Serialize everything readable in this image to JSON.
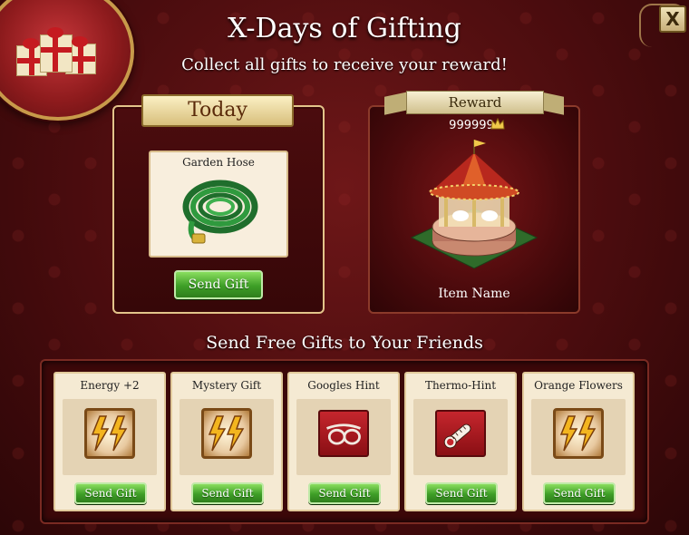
{
  "header": {
    "title": "X-Days of Gifting",
    "subtitle": "Collect all gifts to receive your reward!",
    "close_label": "X"
  },
  "today": {
    "banner": "Today",
    "item_label": "Garden Hose",
    "item_icon": "garden-hose-icon",
    "button_label": "Send Gift"
  },
  "reward": {
    "banner": "Reward",
    "amount": "999999",
    "amount_icon": "crown-icon",
    "item_icon": "carousel-icon",
    "item_name": "Item Name"
  },
  "friends": {
    "title": "Send Free Gifts to Your Friends",
    "gifts": [
      {
        "label": "Energy +2",
        "icon": "energy-bolt-icon",
        "button": "Send Gift"
      },
      {
        "label": "Mystery Gift",
        "icon": "energy-bolt-icon",
        "button": "Send Gift"
      },
      {
        "label": "Googles Hint",
        "icon": "goggles-icon",
        "button": "Send Gift"
      },
      {
        "label": "Thermo-Hint",
        "icon": "thermometer-icon",
        "button": "Send Gift"
      },
      {
        "label": "Orange Flowers",
        "icon": "energy-bolt-icon",
        "button": "Send Gift"
      }
    ]
  },
  "colors": {
    "background": "#4a0c0e",
    "button_green": "#3e9e27",
    "gold_trim": "#e3c48a"
  }
}
